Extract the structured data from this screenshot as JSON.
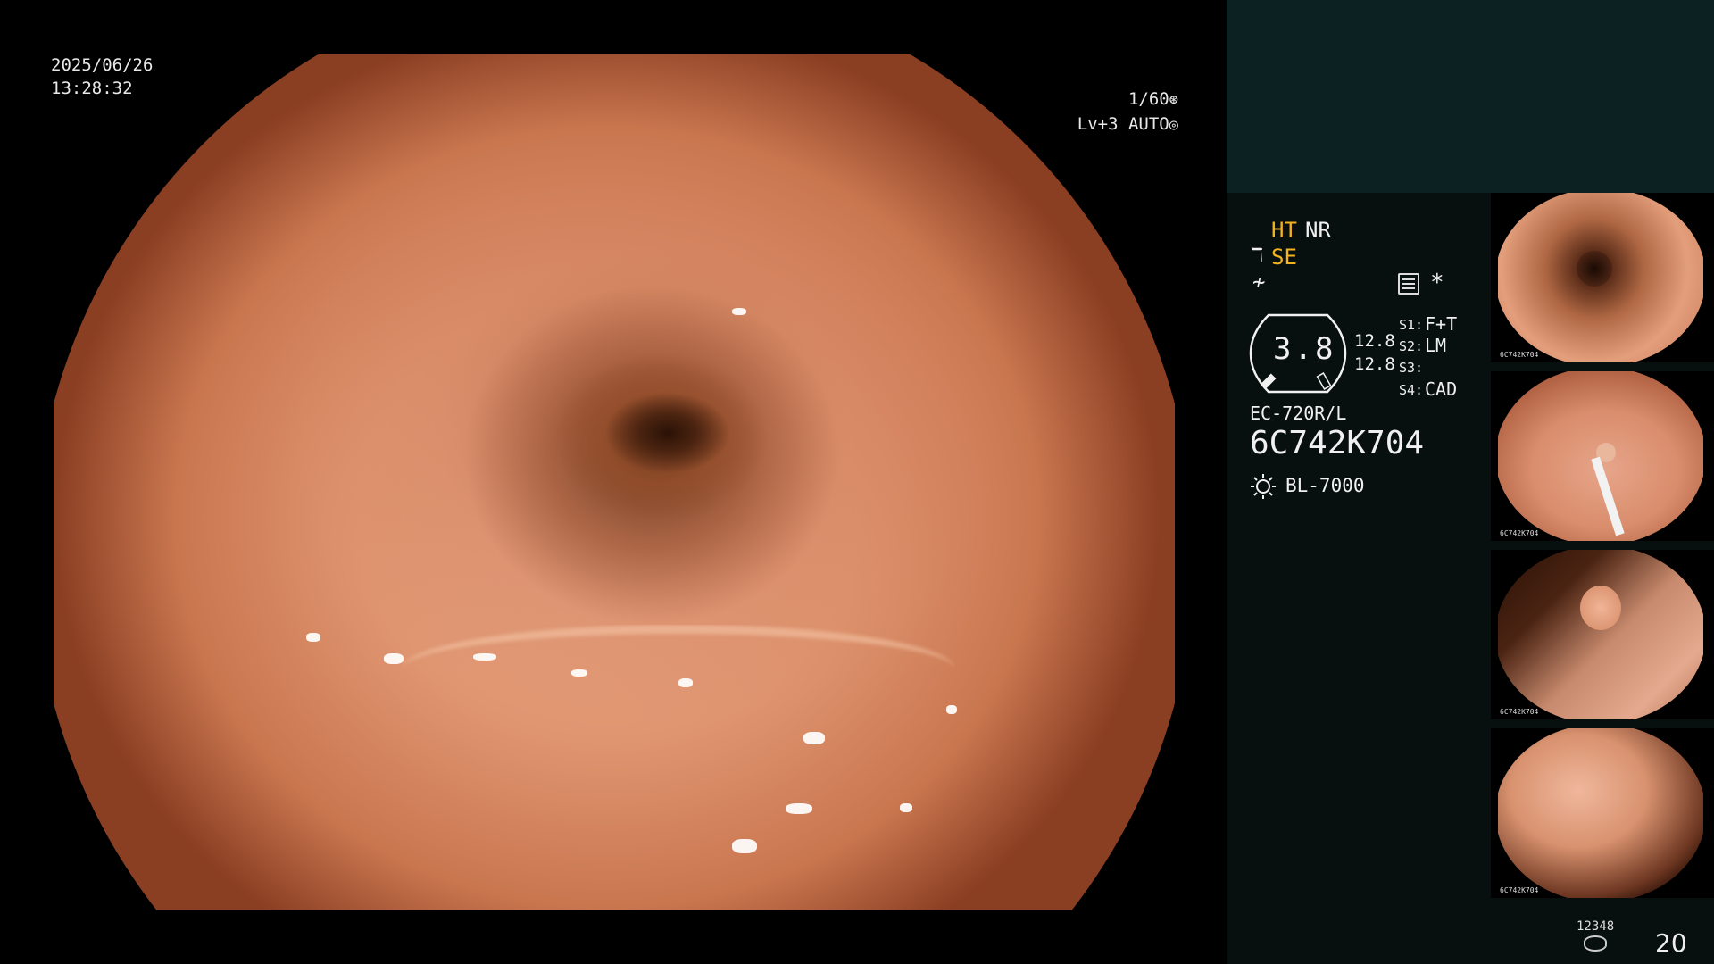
{
  "osd": {
    "date": "2025/06/26",
    "time": "13:28:32",
    "shutter": "1/60",
    "shutter_icon": "shutter-icon",
    "level": "Lv+3 AUTO",
    "level_icon": "auto-iris-icon"
  },
  "settings": {
    "ht": "HT",
    "nr": "NR",
    "se_icon": "structure-enhancement-icon",
    "se": "SE",
    "enhancement_icon": "enhancement-icon",
    "memo_icon": "memo-icon",
    "asterisk": "*",
    "gauge_value": "3.8",
    "value_a": "12.8",
    "value_b": "12.8",
    "slots": [
      {
        "label": "S1:",
        "value": "F+T"
      },
      {
        "label": "S2:",
        "value": "LM"
      },
      {
        "label": "S3:",
        "value": ""
      },
      {
        "label": "S4:",
        "value": "CAD"
      }
    ]
  },
  "device": {
    "scope_model": "EC-720R/L",
    "serial": "6C742K704",
    "light_icon": "light-source-icon",
    "light_model": "BL-7000"
  },
  "thumbnails": [
    {
      "tag": "6C742K704"
    },
    {
      "tag": "6C742K704"
    },
    {
      "tag": "6C742K704"
    },
    {
      "tag": "6C742K704"
    }
  ],
  "footer": {
    "storage_count": "12348",
    "storage_icon": "storage-icon",
    "image_count": "20"
  },
  "colors": {
    "accent": "#f3b21f",
    "panel_header": "#0c2121",
    "panel_bg": "#07100f"
  }
}
